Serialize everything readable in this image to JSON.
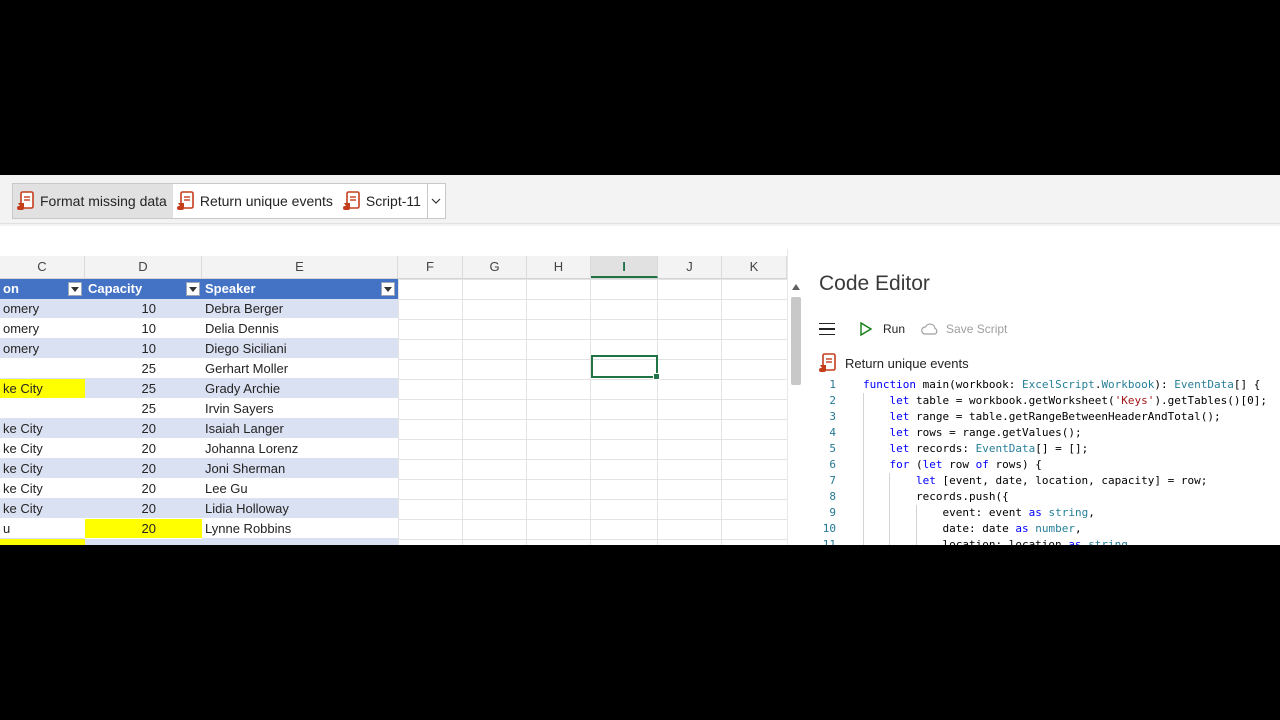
{
  "scripts_gallery": {
    "items": [
      {
        "label": "Format missing data",
        "selected": true
      },
      {
        "label": "Return unique events",
        "selected": false
      },
      {
        "label": "Script-11",
        "selected": false
      }
    ],
    "more_icon": "chevron-down-icon"
  },
  "sheet": {
    "columns": [
      "C",
      "D",
      "E",
      "F",
      "G",
      "H",
      "I",
      "J",
      "K"
    ],
    "active_column": "I",
    "table_headers": [
      "on",
      "Capacity",
      "Speaker"
    ],
    "rows": [
      {
        "c": "omery",
        "d": "10",
        "e": "Debra Berger"
      },
      {
        "c": "omery",
        "d": "10",
        "e": "Delia Dennis"
      },
      {
        "c": "omery",
        "d": "10",
        "e": "Diego Siciliani"
      },
      {
        "c": "",
        "d": "25",
        "e": "Gerhart Moller"
      },
      {
        "c": "ke City",
        "d": "25",
        "e": "Grady Archie"
      },
      {
        "c": "",
        "d": "25",
        "e": "Irvin Sayers"
      },
      {
        "c": "ke City",
        "d": "20",
        "e": "Isaiah Langer"
      },
      {
        "c": "ke City",
        "d": "20",
        "e": "Johanna Lorenz"
      },
      {
        "c": "ke City",
        "d": "20",
        "e": "Joni Sherman"
      },
      {
        "c": "ke City",
        "d": "20",
        "e": "Lee Gu"
      },
      {
        "c": "ke City",
        "d": "20",
        "e": "Lidia Holloway"
      },
      {
        "c": "u",
        "d": "20",
        "e": "Lynne Robbins"
      }
    ],
    "highlight_color": "#ffff00",
    "table_header_color": "#4472c4",
    "band_color": "#d9e1f2"
  },
  "editor": {
    "title": "Code Editor",
    "run_label": "Run",
    "save_label": "Save Script",
    "script_name": "Return unique events",
    "lines": [
      {
        "n": "1",
        "text": "function main(workbook: ExcelScript.Workbook): EventData[] {"
      },
      {
        "n": "2",
        "text": "    let table = workbook.getWorksheet('Keys').getTables()[0];"
      },
      {
        "n": "3",
        "text": "    let range = table.getRangeBetweenHeaderAndTotal();"
      },
      {
        "n": "4",
        "text": "    let rows = range.getValues();"
      },
      {
        "n": "5",
        "text": "    let records: EventData[] = [];"
      },
      {
        "n": "6",
        "text": "    for (let row of rows) {"
      },
      {
        "n": "7",
        "text": "        let [event, date, location, capacity] = row;"
      },
      {
        "n": "8",
        "text": "        records.push({"
      },
      {
        "n": "9",
        "text": "            event: event as string,"
      },
      {
        "n": "10",
        "text": "            date: date as number,"
      },
      {
        "n": "11",
        "text": "            location: location as string,"
      }
    ]
  }
}
